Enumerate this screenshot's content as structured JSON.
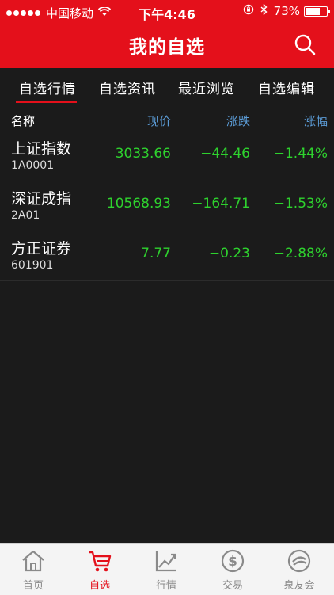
{
  "status_bar": {
    "carrier": "中国移动",
    "time": "下午4:46",
    "battery": "73%",
    "battery_level": 0.73
  },
  "header": {
    "title": "我的自选",
    "search_icon": "search-icon"
  },
  "tabs": [
    {
      "label": "自选行情",
      "active": true
    },
    {
      "label": "自选资讯",
      "active": false
    },
    {
      "label": "最近浏览",
      "active": false
    },
    {
      "label": "自选编辑",
      "active": false
    }
  ],
  "columns": {
    "name": "名称",
    "price": "现价",
    "change": "涨跌",
    "pct": "涨幅"
  },
  "rows": [
    {
      "name": "上证指数",
      "code": "1A0001",
      "price": "3033.66",
      "change": "−44.46",
      "pct": "−1.44%"
    },
    {
      "name": "深证成指",
      "code": "2A01",
      "price": "10568.93",
      "change": "−164.71",
      "pct": "−1.53%"
    },
    {
      "name": "方正证券",
      "code": "601901",
      "price": "7.77",
      "change": "−0.23",
      "pct": "−2.88%"
    }
  ],
  "tabbar": [
    {
      "label": "首页",
      "icon": "home-icon",
      "active": false
    },
    {
      "label": "自选",
      "icon": "cart-icon",
      "active": true
    },
    {
      "label": "行情",
      "icon": "chart-icon",
      "active": false
    },
    {
      "label": "交易",
      "icon": "dollar-icon",
      "active": false
    },
    {
      "label": "泉友会",
      "icon": "community-icon",
      "active": false
    }
  ],
  "colors": {
    "brand_red": "#e4101b",
    "down_green": "#2ed22e",
    "header_blue": "#5b9bd5"
  }
}
